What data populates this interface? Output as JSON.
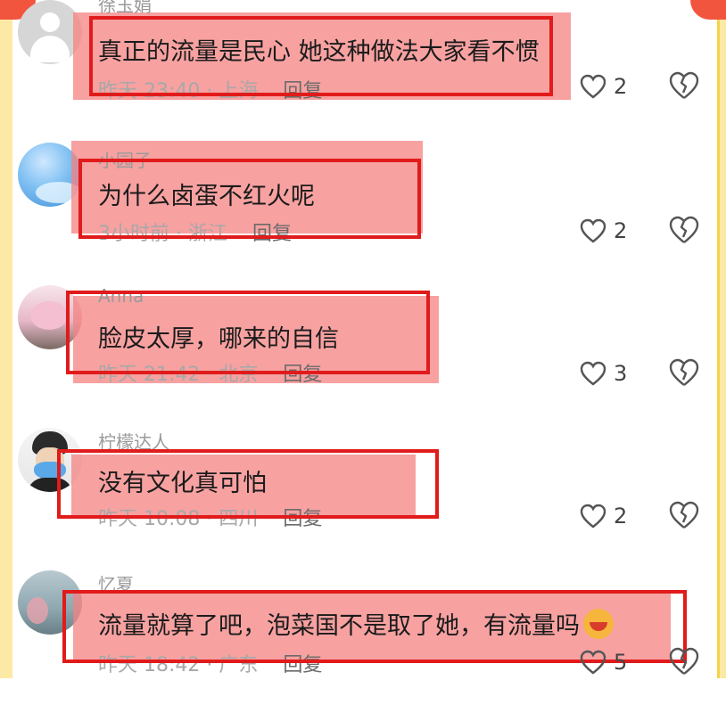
{
  "comments": [
    {
      "username": "徐玉娟",
      "text": "真正的流量是民心 她这种做法大家看不惯",
      "meta": "昨天 23:40 · 上海",
      "reply": "回复",
      "likes": "2",
      "avatar": "default-avatar"
    },
    {
      "username": "小园子",
      "text": "为什么卤蛋不红火呢",
      "meta": "3小时前 · 浙江",
      "reply": "回复",
      "likes": "2",
      "avatar": "blue-gradient-avatar"
    },
    {
      "username": "Anna",
      "text": "脸皮太厚，哪来的自信",
      "meta": "昨天 21:42 · 北京",
      "reply": "回复",
      "likes": "3",
      "avatar": "pink-toy-avatar"
    },
    {
      "username": "柠檬达人",
      "text": "没有文化真可怕",
      "meta": "昨天 10:08 · 四川",
      "reply": "回复",
      "likes": "2",
      "avatar": "masked-person-avatar"
    },
    {
      "username": "忆夏",
      "text": "流量就算了吧，泡菜国不是取了她，有流量吗",
      "meta": "昨天 18:42 · 广东",
      "reply": "回复",
      "likes": "5",
      "avatar": "sea-avatar"
    }
  ],
  "icons": {
    "like": "heart-outline-icon",
    "dislike": "broken-heart-icon",
    "emoji": "grinning-emoji-icon"
  },
  "colors": {
    "highlight": "#f48282",
    "box": "#e11b1b",
    "frame": "#fde9a6"
  }
}
